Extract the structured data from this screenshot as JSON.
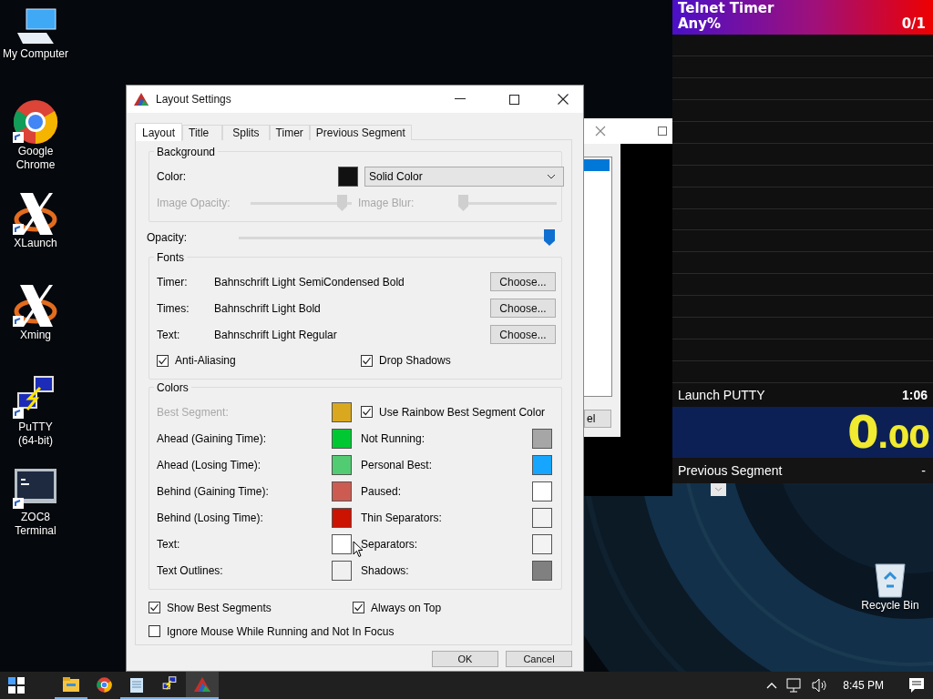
{
  "desktop_icons": [
    {
      "label": "My Computer",
      "kind": "computer"
    },
    {
      "label": "Google\nChrome",
      "kind": "chrome"
    },
    {
      "label": "XLaunch",
      "kind": "xlogo"
    },
    {
      "label": "Xming",
      "kind": "xlogo"
    },
    {
      "label": "PuTTY\n(64-bit)",
      "kind": "putty"
    },
    {
      "label": "ZOC8\nTerminal",
      "kind": "terminal"
    }
  ],
  "recycle_bin": {
    "label": "Recycle Bin"
  },
  "background_window": {
    "button": "el"
  },
  "timer": {
    "title": "Telnet Timer",
    "category": "Any%",
    "attempts": "0/1",
    "split": {
      "name": "Launch PUTTY",
      "time": "1:06"
    },
    "time_main": "0",
    "time_decimals": ".00",
    "previous_segment": {
      "label": "Previous Segment",
      "value": "-"
    }
  },
  "dialog": {
    "title": "Layout Settings",
    "tabs": [
      {
        "label": "Layout",
        "selected": true
      },
      {
        "label": "Title",
        "selected": false
      },
      {
        "label": "Splits",
        "selected": false
      },
      {
        "label": "Timer",
        "selected": false
      },
      {
        "label": "Previous Segment",
        "selected": false
      }
    ],
    "background": {
      "heading": "Background",
      "color_label": "Color:",
      "color": "#111111",
      "fill_type": "Solid Color",
      "image_opacity": {
        "label": "Image Opacity:",
        "level": 0.95
      },
      "image_blur": {
        "label": "Image Blur:",
        "level": 0
      }
    },
    "opacity": {
      "label": "Opacity:",
      "level": 1
    },
    "fonts": {
      "heading": "Fonts",
      "rows": [
        {
          "label": "Timer:",
          "font": "Bahnschrift Light SemiCondensed Bold",
          "button": "Choose..."
        },
        {
          "label": "Times:",
          "font": "Bahnschrift Light Bold",
          "button": "Choose..."
        },
        {
          "label": "Text:",
          "font": "Bahnschrift Light Regular",
          "button": "Choose..."
        }
      ],
      "anti_aliasing": {
        "label": "Anti-Aliasing",
        "checked": true
      },
      "drop_shadows": {
        "label": "Drop Shadows",
        "checked": true
      }
    },
    "colors": {
      "heading": "Colors",
      "rainbow": {
        "label": "Use Rainbow Best Segment Color",
        "checked": true
      },
      "left": [
        {
          "label": "Best Segment:",
          "color": "#d9a81f",
          "disabled": true
        },
        {
          "label": "Ahead (Gaining Time):",
          "color": "#00c832",
          "disabled": false
        },
        {
          "label": "Ahead (Losing Time):",
          "color": "#52cc73",
          "disabled": false
        },
        {
          "label": "Behind (Gaining Time):",
          "color": "#cc5c52",
          "disabled": false
        },
        {
          "label": "Behind (Losing Time):",
          "color": "#cc1200",
          "disabled": false
        },
        {
          "label": "Text:",
          "color": "#ffffff",
          "disabled": false
        },
        {
          "label": "Text Outlines:",
          "color": "#f0f0f0",
          "disabled": false
        }
      ],
      "right": [
        {
          "label": "Not Running:",
          "color": "#a6a6a6"
        },
        {
          "label": "Personal Best:",
          "color": "#16a6ff"
        },
        {
          "label": "Paused:",
          "color": "#ffffff"
        },
        {
          "label": "Thin Separators:",
          "color": "#f2f2f2"
        },
        {
          "label": "Separators:",
          "color": "#f3f3f3"
        },
        {
          "label": "Shadows:",
          "color": "#808080"
        }
      ]
    },
    "show_best_segments": {
      "label": "Show Best Segments",
      "checked": true
    },
    "always_on_top": {
      "label": "Always on Top",
      "checked": true
    },
    "ignore_mouse": {
      "label": "Ignore Mouse While Running and Not In Focus",
      "checked": false
    },
    "buttons": [
      "OK",
      "Cancel"
    ]
  },
  "taskbar": {
    "apps": [
      {
        "kind": "explorer",
        "running": true,
        "selected": false
      },
      {
        "kind": "chrome",
        "running": false,
        "selected": false
      },
      {
        "kind": "notepad",
        "running": true,
        "selected": false
      },
      {
        "kind": "putty",
        "running": true,
        "selected": false
      },
      {
        "kind": "livesplit",
        "running": true,
        "selected": true
      }
    ],
    "clock": "8:45 PM"
  }
}
